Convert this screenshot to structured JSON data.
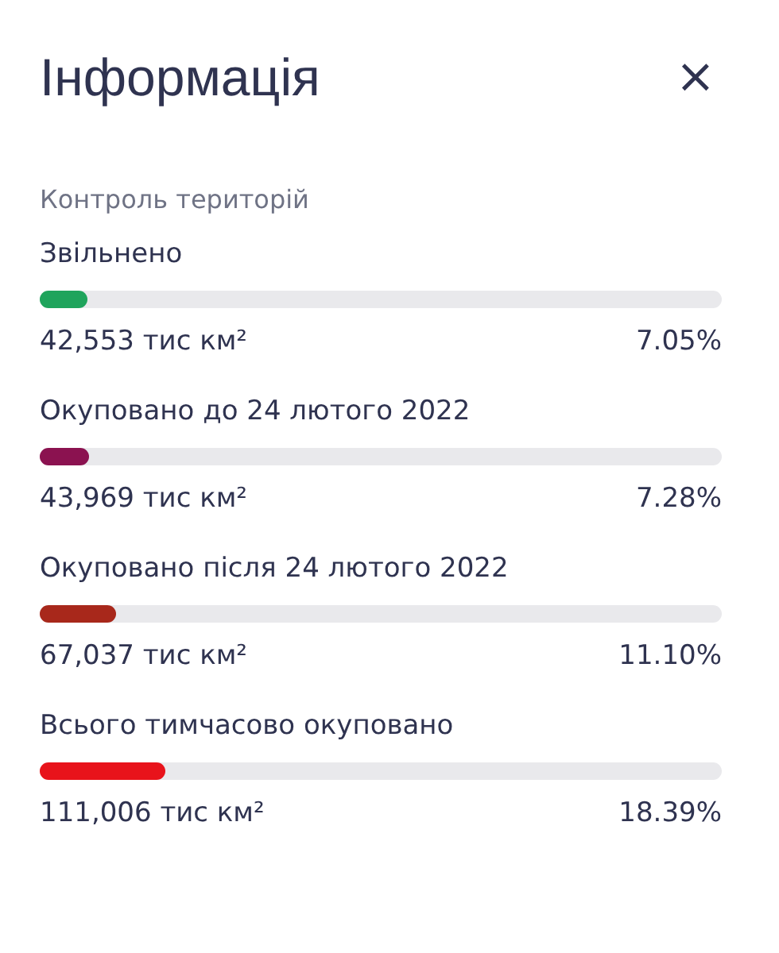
{
  "panel": {
    "title": "Інформація",
    "close": "×"
  },
  "section": {
    "title": "Контроль територій"
  },
  "items": [
    {
      "label": "Звільнено",
      "level": 0.0705,
      "color": "#1fa45c",
      "area": "42,553 тис км²",
      "percent": "7.05%"
    },
    {
      "label": "Окуповано до 24 лютого 2022",
      "level": 0.0728,
      "color": "#8b1250",
      "area": "43,969 тис км²",
      "percent": "7.28%"
    },
    {
      "label": "Окуповано після 24 лютого 2022",
      "level": 0.111,
      "color": "#a8281b",
      "area": "67,037 тис км²",
      "percent": "11.10%"
    },
    {
      "label": "Всього тимчасово окуповано",
      "level": 0.1839,
      "color": "#e8131b",
      "area": "111,006 тис км²",
      "percent": "18.39%"
    }
  ]
}
